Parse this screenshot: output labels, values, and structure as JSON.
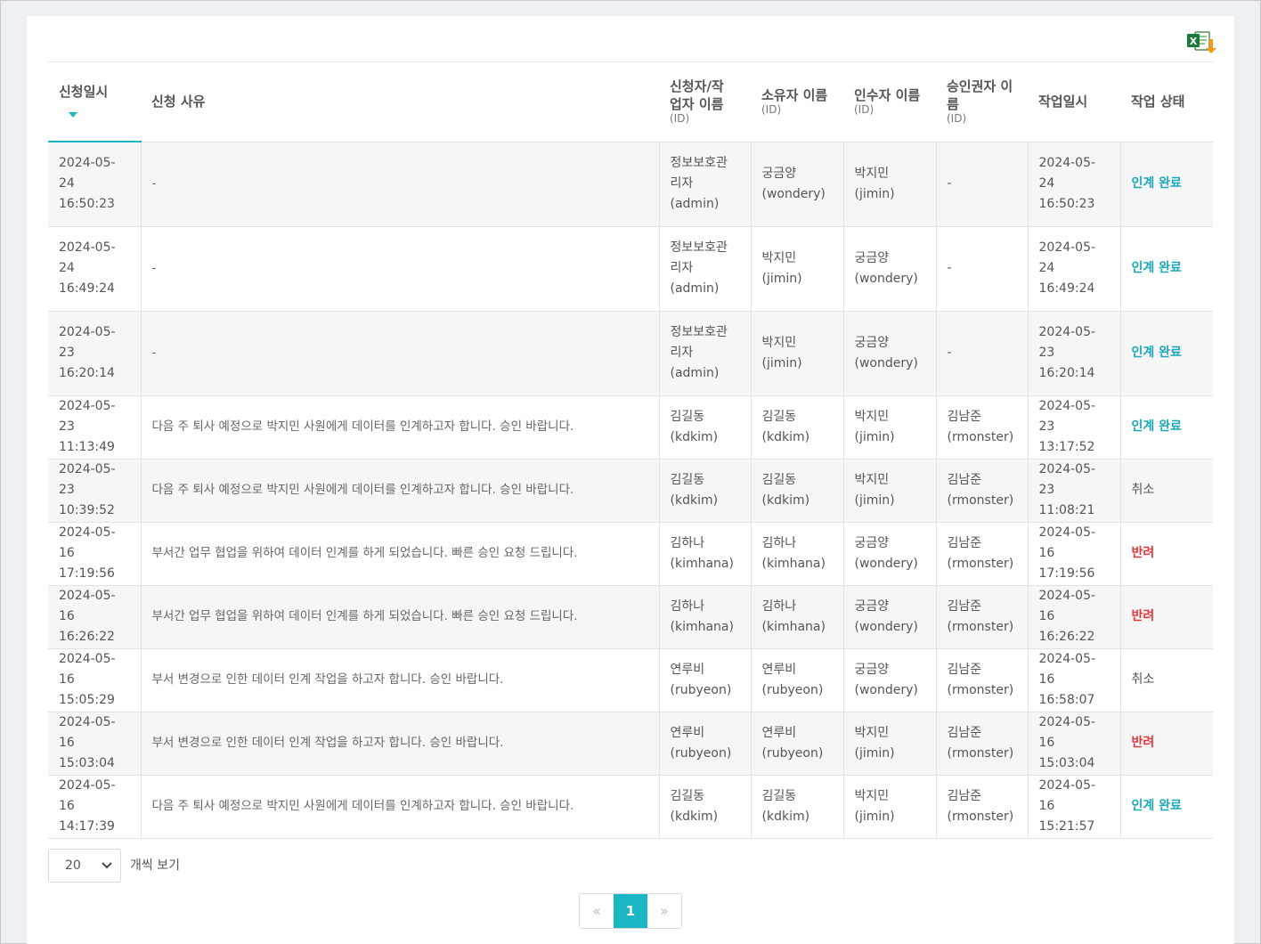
{
  "headers": {
    "requested_at": "신청일시",
    "reason": "신청 사유",
    "applicant_line1": "신청자/작",
    "applicant_line2": "업자 이름",
    "applicant_id": "(ID)",
    "owner": "소유자 이름",
    "owner_id": "(ID)",
    "receiver": "인수자 이름",
    "receiver_id": "(ID)",
    "approver_line1": "승인권자 이",
    "approver_line2": "름",
    "approver_id": "(ID)",
    "worked_at": "작업일시",
    "status": "작업 상태"
  },
  "rows": [
    {
      "req_date": "2024-05-24",
      "req_time": "16:50:23",
      "reason": "-",
      "applicant": [
        "정보보호관",
        "리자",
        "(admin)"
      ],
      "owner": [
        "궁금양",
        "(wondery)"
      ],
      "receiver": [
        "박지민",
        "(jimin)"
      ],
      "approver": [
        "-",
        ""
      ],
      "work_date": "2024-05-24",
      "work_time": "16:50:23",
      "status": "인계 완료",
      "status_type": "complete"
    },
    {
      "req_date": "2024-05-24",
      "req_time": "16:49:24",
      "reason": "-",
      "applicant": [
        "정보보호관",
        "리자",
        "(admin)"
      ],
      "owner": [
        "박지민",
        "(jimin)"
      ],
      "receiver": [
        "궁금양",
        "(wondery)"
      ],
      "approver": [
        "-",
        ""
      ],
      "work_date": "2024-05-24",
      "work_time": "16:49:24",
      "status": "인계 완료",
      "status_type": "complete"
    },
    {
      "req_date": "2024-05-23",
      "req_time": "16:20:14",
      "reason": "-",
      "applicant": [
        "정보보호관",
        "리자",
        "(admin)"
      ],
      "owner": [
        "박지민",
        "(jimin)"
      ],
      "receiver": [
        "궁금양",
        "(wondery)"
      ],
      "approver": [
        "-",
        ""
      ],
      "work_date": "2024-05-23",
      "work_time": "16:20:14",
      "status": "인계 완료",
      "status_type": "complete"
    },
    {
      "req_date": "2024-05-23",
      "req_time": "11:13:49",
      "reason": "다음 주 퇴사 예정으로 박지민 사원에게 데이터를 인계하고자 합니다. 승인 바랍니다.",
      "applicant": [
        "김길동",
        "(kdkim)",
        ""
      ],
      "owner": [
        "김길동",
        "(kdkim)"
      ],
      "receiver": [
        "박지민",
        "(jimin)"
      ],
      "approver": [
        "김남준",
        "(rmonster)"
      ],
      "work_date": "2024-05-23",
      "work_time": "13:17:52",
      "status": "인계 완료",
      "status_type": "complete"
    },
    {
      "req_date": "2024-05-23",
      "req_time": "10:39:52",
      "reason": "다음 주 퇴사 예정으로 박지민 사원에게 데이터를 인계하고자 합니다. 승인 바랍니다.",
      "applicant": [
        "김길동",
        "(kdkim)",
        ""
      ],
      "owner": [
        "김길동",
        "(kdkim)"
      ],
      "receiver": [
        "박지민",
        "(jimin)"
      ],
      "approver": [
        "김남준",
        "(rmonster)"
      ],
      "work_date": "2024-05-23",
      "work_time": "11:08:21",
      "status": "취소",
      "status_type": "cancel"
    },
    {
      "req_date": "2024-05-16",
      "req_time": "17:19:56",
      "reason": "부서간 업무 협업을 위하여 데이터 인계를 하게 되었습니다. 빠른 승인 요청 드립니다.",
      "applicant": [
        "김하나",
        "(kimhana)",
        ""
      ],
      "owner": [
        "김하나",
        "(kimhana)"
      ],
      "receiver": [
        "궁금양",
        "(wondery)"
      ],
      "approver": [
        "김남준",
        "(rmonster)"
      ],
      "work_date": "2024-05-16",
      "work_time": "17:19:56",
      "status": "반려",
      "status_type": "rejected"
    },
    {
      "req_date": "2024-05-16",
      "req_time": "16:26:22",
      "reason": "부서간 업무 협업을 위하여 데이터 인계를 하게 되었습니다. 빠른 승인 요청 드립니다.",
      "applicant": [
        "김하나",
        "(kimhana)",
        ""
      ],
      "owner": [
        "김하나",
        "(kimhana)"
      ],
      "receiver": [
        "궁금양",
        "(wondery)"
      ],
      "approver": [
        "김남준",
        "(rmonster)"
      ],
      "work_date": "2024-05-16",
      "work_time": "16:26:22",
      "status": "반려",
      "status_type": "rejected"
    },
    {
      "req_date": "2024-05-16",
      "req_time": "15:05:29",
      "reason": "부서 변경으로 인한 데이터 인계 작업을 하고자 합니다. 승인 바랍니다.",
      "applicant": [
        "연루비",
        "(rubyeon)",
        ""
      ],
      "owner": [
        "연루비",
        "(rubyeon)"
      ],
      "receiver": [
        "궁금양",
        "(wondery)"
      ],
      "approver": [
        "김남준",
        "(rmonster)"
      ],
      "work_date": "2024-05-16",
      "work_time": "16:58:07",
      "status": "취소",
      "status_type": "cancel"
    },
    {
      "req_date": "2024-05-16",
      "req_time": "15:03:04",
      "reason": "부서 변경으로 인한 데이터 인계 작업을 하고자 합니다. 승인 바랍니다.",
      "applicant": [
        "연루비",
        "(rubyeon)",
        ""
      ],
      "owner": [
        "연루비",
        "(rubyeon)"
      ],
      "receiver": [
        "박지민",
        "(jimin)"
      ],
      "approver": [
        "김남준",
        "(rmonster)"
      ],
      "work_date": "2024-05-16",
      "work_time": "15:03:04",
      "status": "반려",
      "status_type": "rejected"
    },
    {
      "req_date": "2024-05-16",
      "req_time": "14:17:39",
      "reason": "다음 주 퇴사 예정으로 박지민 사원에게 데이터를 인계하고자 합니다. 승인 바랍니다.",
      "applicant": [
        "김길동",
        "(kdkim)",
        ""
      ],
      "owner": [
        "김길동",
        "(kdkim)"
      ],
      "receiver": [
        "박지민",
        "(jimin)"
      ],
      "approver": [
        "김남준",
        "(rmonster)"
      ],
      "work_date": "2024-05-16",
      "work_time": "15:21:57",
      "status": "인계 완료",
      "status_type": "complete"
    }
  ],
  "footer": {
    "page_size": "20",
    "page_size_label": "개씩 보기"
  },
  "pagination": {
    "prev": "«",
    "current": "1",
    "next": "»"
  },
  "icons": {
    "excel": "excel-download-icon",
    "sort": "sort-desc-icon",
    "select": "chevron-down-icon"
  },
  "colors": {
    "accent": "#1ab6c4",
    "complete": "#1aa9ba",
    "rejected": "#e5383b"
  }
}
